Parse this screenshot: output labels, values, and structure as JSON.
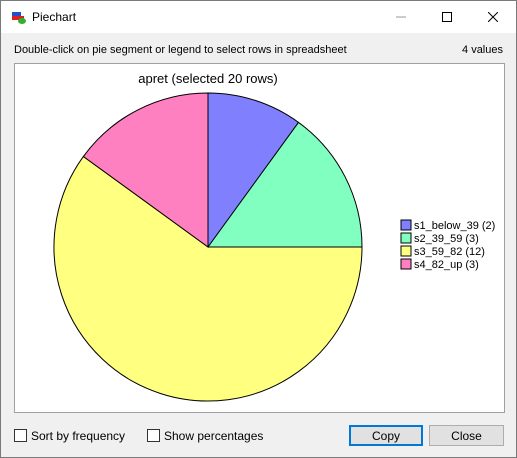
{
  "window": {
    "title": "Piechart",
    "hint": "Double-click on pie segment or legend to select rows in spreadsheet",
    "value_count": "4 values"
  },
  "chart_data": {
    "type": "pie",
    "title": "apret (selected 20 rows)",
    "series": [
      {
        "name": "s1_below_39",
        "value": 2,
        "label": "s1_below_39 (2)",
        "color": "#8080ff"
      },
      {
        "name": "s2_39_59",
        "value": 3,
        "label": "s2_39_59 (3)",
        "color": "#80ffc0"
      },
      {
        "name": "s3_59_82",
        "value": 12,
        "label": "s3_59_82 (12)",
        "color": "#ffff80"
      },
      {
        "name": "s4_82_up",
        "value": 3,
        "label": "s4_82_up (3)",
        "color": "#ff80c0"
      }
    ],
    "legend_placement": "right"
  },
  "controls": {
    "sort_by_frequency": "Sort by frequency",
    "show_percentages": "Show percentages",
    "copy": "Copy",
    "close": "Close"
  }
}
